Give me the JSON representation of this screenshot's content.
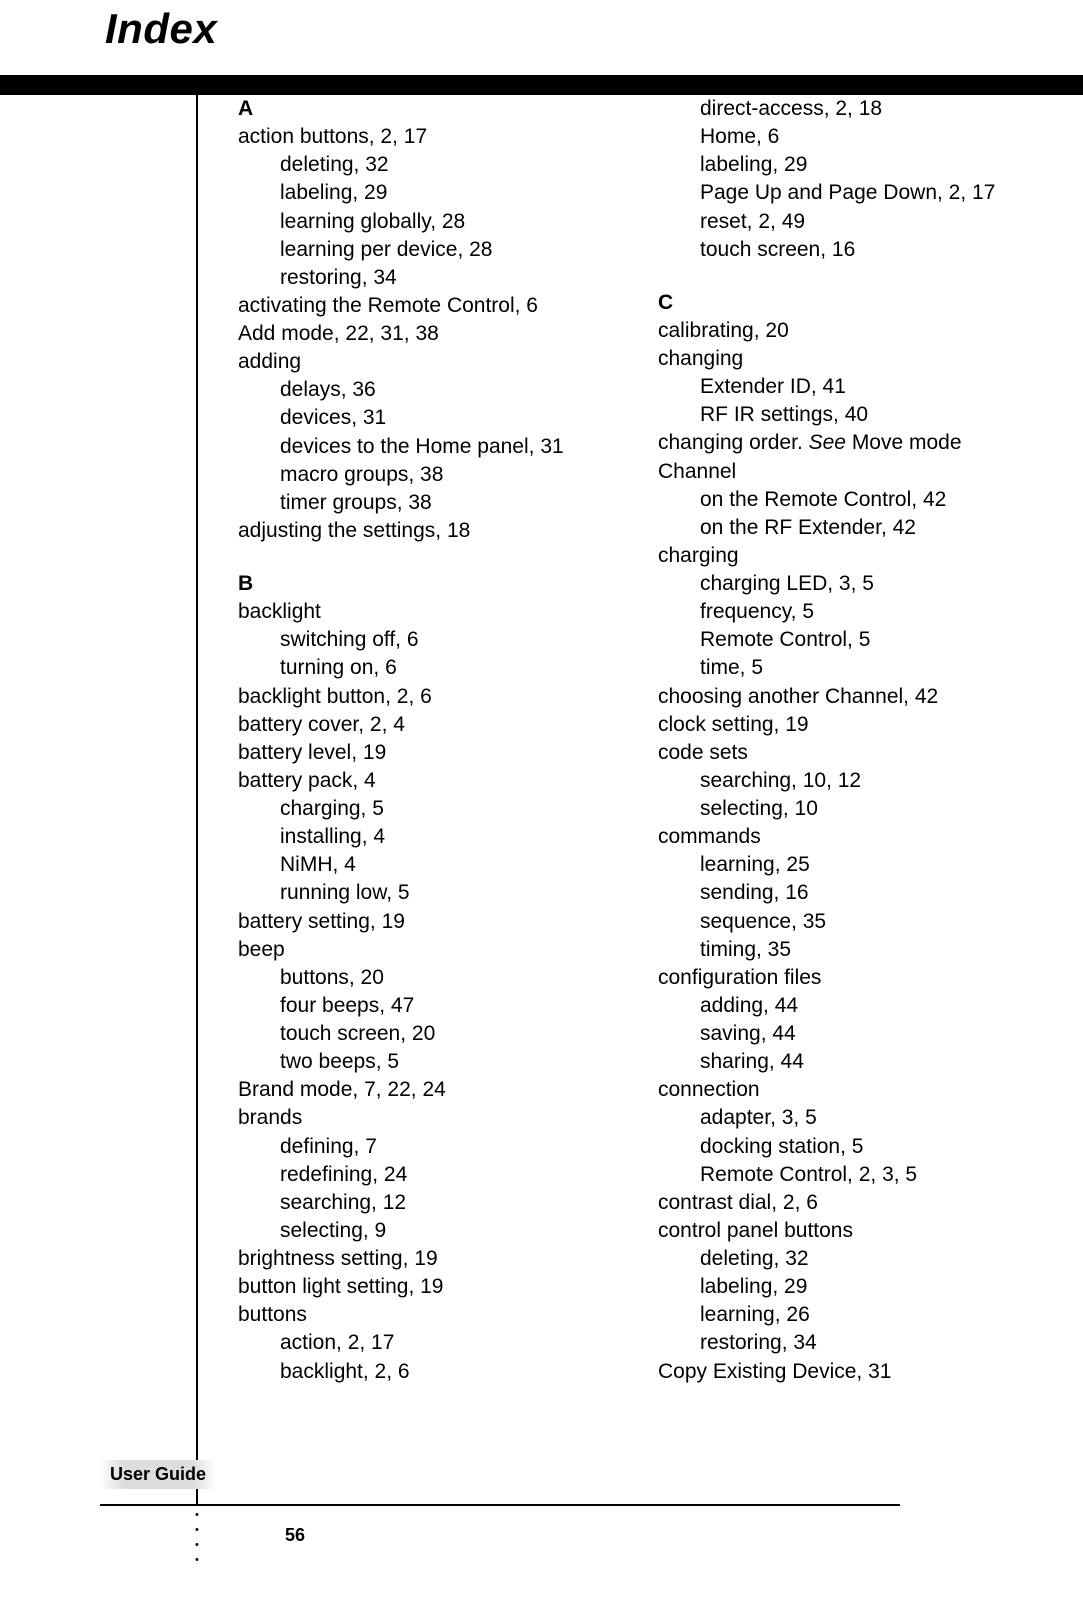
{
  "title": "Index",
  "footer_label": "User Guide",
  "page_number": "56",
  "col1": {
    "A_letter": "A",
    "a1": "action buttons, 2, 17",
    "a1s1": "deleting, 32",
    "a1s2": "labeling, 29",
    "a1s3": "learning globally, 28",
    "a1s4": "learning per device, 28",
    "a1s5": "restoring, 34",
    "a2": "activating the Remote Control, 6",
    "a3": "Add mode, 22, 31, 38",
    "a4": "adding",
    "a4s1": "delays, 36",
    "a4s2": "devices, 31",
    "a4s3": "devices to the Home panel, 31",
    "a4s4": "macro groups, 38",
    "a4s5": "timer groups, 38",
    "a5": "adjusting the settings, 18",
    "B_letter": "B",
    "b1": "backlight",
    "b1s1": "switching off, 6",
    "b1s2": "turning on, 6",
    "b2": "backlight button, 2, 6",
    "b3": "battery cover, 2, 4",
    "b4": "battery level, 19",
    "b5": "battery pack, 4",
    "b5s1": "charging, 5",
    "b5s2": "installing, 4",
    "b5s3": "NiMH, 4",
    "b5s4": "running low, 5",
    "b6": "battery setting, 19",
    "b7": "beep",
    "b7s1": "buttons, 20",
    "b7s2": "four beeps, 47",
    "b7s3": "touch screen, 20",
    "b7s4": "two beeps, 5",
    "b8": "Brand mode, 7, 22, 24",
    "b9": "brands",
    "b9s1": "defining, 7",
    "b9s2": "redefining, 24",
    "b9s3": "searching, 12",
    "b9s4": "selecting, 9",
    "b10": "brightness setting, 19",
    "b11": "button light setting, 19",
    "b12": "buttons",
    "b12s1": "action, 2, 17",
    "b12s2": "backlight, 2, 6"
  },
  "col2": {
    "t1": "direct-access, 2, 18",
    "t2": "Home, 6",
    "t3": "labeling, 29",
    "t4": "Page Up and Page Down, 2, 17",
    "t5": "reset, 2, 49",
    "t6": "touch screen, 16",
    "C_letter": "C",
    "c1": "calibrating, 20",
    "c2": "changing",
    "c2s1": "Extender ID, 41",
    "c2s2": "RF IR settings, 40",
    "c3a": "changing order. ",
    "c3see": "See",
    "c3b": " Move mode",
    "c4": "Channel",
    "c4s1": "on the Remote Control, 42",
    "c4s2": "on the RF Extender, 42",
    "c5": "charging",
    "c5s1": "charging LED, 3, 5",
    "c5s2": "frequency, 5",
    "c5s3": "Remote Control, 5",
    "c5s4": "time, 5",
    "c6": "choosing another Channel, 42",
    "c7": "clock setting, 19",
    "c8": "code sets",
    "c8s1": "searching, 10, 12",
    "c8s2": "selecting, 10",
    "c9": "commands",
    "c9s1": "learning, 25",
    "c9s2": "sending, 16",
    "c9s3": "sequence, 35",
    "c9s4": "timing, 35",
    "c10": "configuration files",
    "c10s1": "adding, 44",
    "c10s2": "saving, 44",
    "c10s3": "sharing, 44",
    "c11": "connection",
    "c11s1": "adapter, 3, 5",
    "c11s2": "docking station, 5",
    "c11s3": "Remote Control, 2, 3, 5",
    "c12": "contrast dial, 2, 6",
    "c13": "control panel buttons",
    "c13s1": "deleting, 32",
    "c13s2": "labeling, 29",
    "c13s3": "learning, 26",
    "c13s4": "restoring, 34",
    "c14": "Copy Existing Device, 31"
  }
}
